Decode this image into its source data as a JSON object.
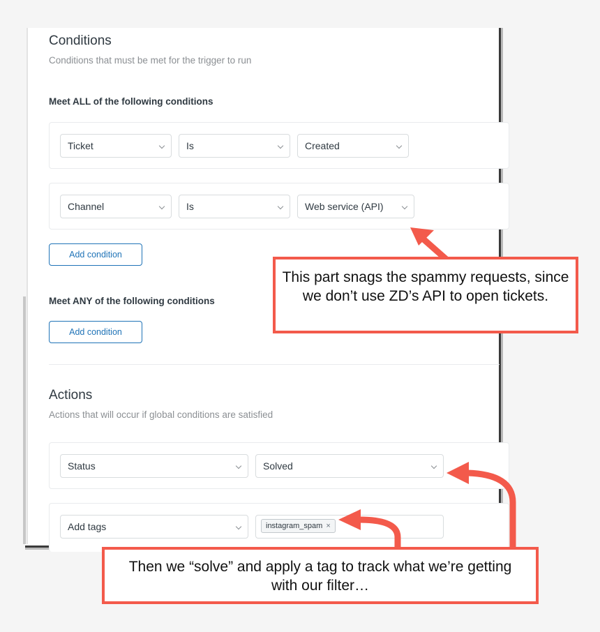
{
  "conditions": {
    "title": "Conditions",
    "subtitle": "Conditions that must be met for the trigger to run",
    "all_heading": "Meet ALL of the following conditions",
    "all_rows": [
      {
        "field": "Ticket",
        "operator": "Is",
        "value": "Created"
      },
      {
        "field": "Channel",
        "operator": "Is",
        "value": "Web service (API)"
      }
    ],
    "add_condition_all": "Add condition",
    "any_heading": "Meet ANY of the following conditions",
    "add_condition_any": "Add condition"
  },
  "actions": {
    "title": "Actions",
    "subtitle": "Actions that will occur if global conditions are satisfied",
    "rows": [
      {
        "field": "Status",
        "value": "Solved"
      },
      {
        "field": "Add tags",
        "tags": [
          {
            "label": "instagram_spam",
            "remove": "×"
          }
        ]
      }
    ]
  },
  "annotations": {
    "callout_conditions": "This part snags the spammy requests, since we don’t use ZD’s API to open tickets.",
    "callout_actions": "Then we “solve” and apply a tag to track what we’re getting with our filter…",
    "accent_color": "#f35a4b"
  },
  "theme": {
    "link_blue": "#1f73b7",
    "text_dark": "#2f3941",
    "text_muted": "#8b8f93"
  }
}
